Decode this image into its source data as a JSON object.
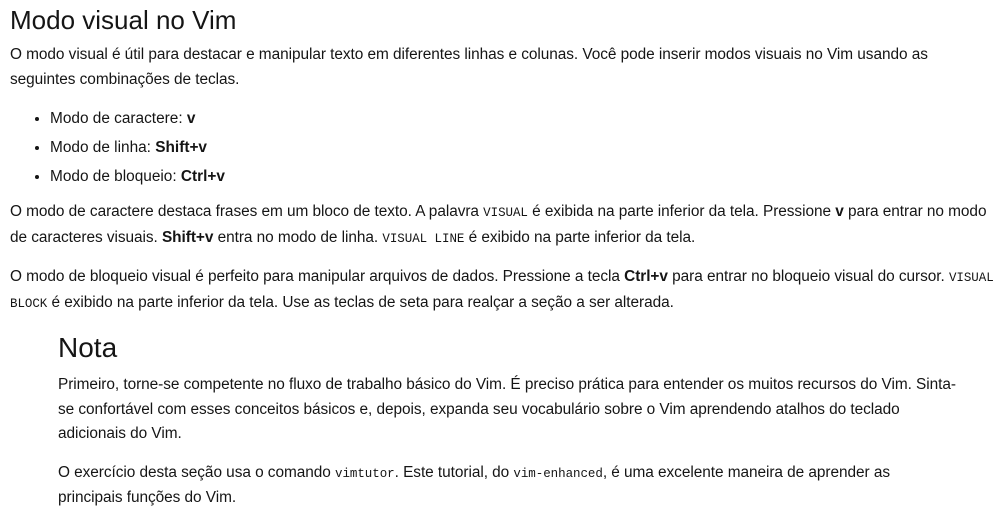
{
  "title": "Modo visual no Vim",
  "intro": "O modo visual é útil para destacar e manipular texto em diferentes linhas e colunas. Você pode inserir modos visuais no Vim usando as seguintes combinações de teclas.",
  "modes": [
    {
      "label": "Modo de caractere: ",
      "key": "v"
    },
    {
      "label": "Modo de linha: ",
      "key": "Shift+v"
    },
    {
      "label": "Modo de bloqueio: ",
      "key": "Ctrl+v"
    }
  ],
  "para_char": {
    "t1": "O modo de caractere destaca frases em um bloco de texto. A palavra ",
    "code1": "VISUAL",
    "t2": " é exibida na parte inferior da tela. Pressione ",
    "key1": "v",
    "t3": " para entrar no modo de caracteres visuais. ",
    "key2": "Shift+v",
    "t4": " entra no modo de linha. ",
    "code2": "VISUAL LINE",
    "t5": " é exibido na parte inferior da tela."
  },
  "para_block": {
    "t1": "O modo de bloqueio visual é perfeito para manipular arquivos de dados. Pressione a tecla ",
    "key1": "Ctrl+v",
    "t2": " para entrar no bloqueio visual do cursor. ",
    "code1": "VISUAL BLOCK",
    "t3": " é exibido na parte inferior da tela. Use as teclas de seta para realçar a seção a ser alterada."
  },
  "note": {
    "heading": "Nota",
    "p1": "Primeiro, torne-se competente no fluxo de trabalho básico do Vim. É preciso prática para entender os muitos recursos do Vim. Sinta-se confortável com esses conceitos básicos e, depois, expanda seu vocabulário sobre o Vim aprendendo atalhos do teclado adicionais do Vim.",
    "p2": {
      "t1": "O exercício desta seção usa o comando ",
      "code1": "vimtutor",
      "t2": ". Este tutorial, do ",
      "code2": "vim-enhanced",
      "t3": ", é uma excelente maneira de aprender as principais funções do Vim."
    }
  }
}
